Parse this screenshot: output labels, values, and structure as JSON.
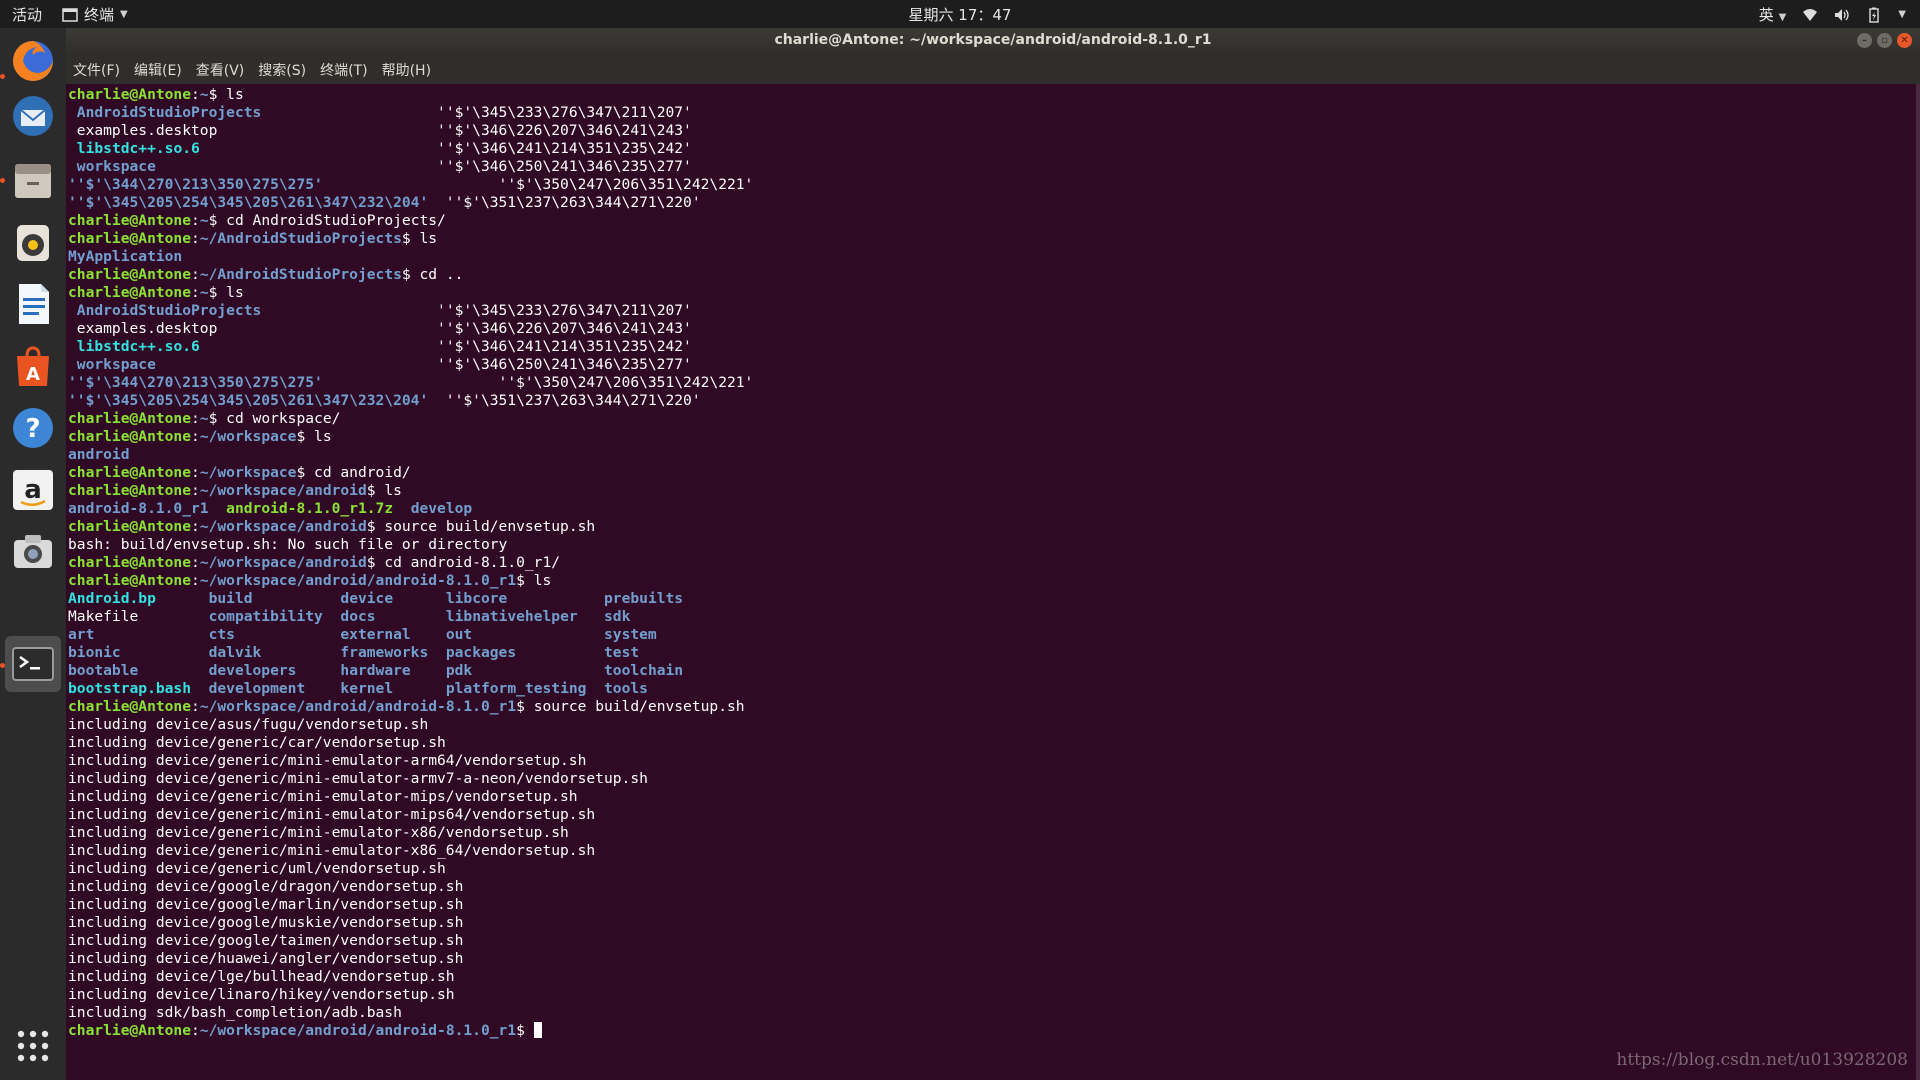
{
  "top_panel": {
    "activities": "活动",
    "app_menu": "终端",
    "clock": "星期六 17：47",
    "input_method": "英"
  },
  "window": {
    "title": "charlie@Antone: ~/workspace/android/android-8.1.0_r1"
  },
  "menubar": [
    "文件(F)",
    "编辑(E)",
    "查看(V)",
    "搜索(S)",
    "终端(T)",
    "帮助(H)"
  ],
  "dock": {
    "items": [
      {
        "name": "firefox"
      },
      {
        "name": "thunderbird"
      },
      {
        "name": "files"
      },
      {
        "name": "rhythmbox"
      },
      {
        "name": "libreoffice-writer"
      },
      {
        "name": "ubuntu-software"
      },
      {
        "name": "help"
      },
      {
        "name": "amazon"
      },
      {
        "name": "screenshot"
      },
      {
        "name": "terminal"
      }
    ]
  },
  "colors": {
    "terminal_bg": "#300a24",
    "prompt_green": "#8ae234",
    "dir_blue": "#729fcf",
    "link_cyan": "#34e2e2",
    "accent_orange": "#e95420"
  },
  "terminal": {
    "user": "charlie@Antone",
    "lines": [
      [
        {
          "t": "charlie@Antone",
          "c": "prompt"
        },
        {
          "t": ":"
        },
        {
          "t": "~",
          "c": "path"
        },
        {
          "t": "$ ls"
        }
      ],
      [
        {
          "t": " "
        },
        {
          "t": "AndroidStudioProjects",
          "c": "dir"
        },
        {
          "t": "                    ''$'\\345\\233\\276\\347\\211\\207'"
        }
      ],
      [
        {
          "t": " examples.desktop                         ''$'\\346\\226\\207\\346\\241\\243'"
        }
      ],
      [
        {
          "t": " "
        },
        {
          "t": "libstdc++.so.6",
          "c": "link"
        },
        {
          "t": "                           ''$'\\346\\241\\214\\351\\235\\242'"
        }
      ],
      [
        {
          "t": " "
        },
        {
          "t": "workspace",
          "c": "dir"
        },
        {
          "t": "                                ''$'\\346\\250\\241\\346\\235\\277'"
        }
      ],
      [
        {
          "t": "''$'\\344\\270\\213\\350\\275\\275'",
          "c": "dir"
        },
        {
          "t": "                    ''$'\\350\\247\\206\\351\\242\\221'"
        }
      ],
      [
        {
          "t": "''$'\\345\\205\\254\\345\\205\\261\\347\\232\\204'",
          "c": "dir"
        },
        {
          "t": "  ''$'\\351\\237\\263\\344\\271\\220'"
        }
      ],
      [
        {
          "t": "charlie@Antone",
          "c": "prompt"
        },
        {
          "t": ":"
        },
        {
          "t": "~",
          "c": "path"
        },
        {
          "t": "$ cd AndroidStudioProjects/"
        }
      ],
      [
        {
          "t": "charlie@Antone",
          "c": "prompt"
        },
        {
          "t": ":"
        },
        {
          "t": "~/AndroidStudioProjects",
          "c": "path"
        },
        {
          "t": "$ ls"
        }
      ],
      [
        {
          "t": "MyApplication",
          "c": "dir"
        }
      ],
      [
        {
          "t": "charlie@Antone",
          "c": "prompt"
        },
        {
          "t": ":"
        },
        {
          "t": "~/AndroidStudioProjects",
          "c": "path"
        },
        {
          "t": "$ cd .."
        }
      ],
      [
        {
          "t": "charlie@Antone",
          "c": "prompt"
        },
        {
          "t": ":"
        },
        {
          "t": "~",
          "c": "path"
        },
        {
          "t": "$ ls"
        }
      ],
      [
        {
          "t": " "
        },
        {
          "t": "AndroidStudioProjects",
          "c": "dir"
        },
        {
          "t": "                    ''$'\\345\\233\\276\\347\\211\\207'"
        }
      ],
      [
        {
          "t": " examples.desktop                         ''$'\\346\\226\\207\\346\\241\\243'"
        }
      ],
      [
        {
          "t": " "
        },
        {
          "t": "libstdc++.so.6",
          "c": "link"
        },
        {
          "t": "                           ''$'\\346\\241\\214\\351\\235\\242'"
        }
      ],
      [
        {
          "t": " "
        },
        {
          "t": "workspace",
          "c": "dir"
        },
        {
          "t": "                                ''$'\\346\\250\\241\\346\\235\\277'"
        }
      ],
      [
        {
          "t": "''$'\\344\\270\\213\\350\\275\\275'",
          "c": "dir"
        },
        {
          "t": "                    ''$'\\350\\247\\206\\351\\242\\221'"
        }
      ],
      [
        {
          "t": "''$'\\345\\205\\254\\345\\205\\261\\347\\232\\204'",
          "c": "dir"
        },
        {
          "t": "  ''$'\\351\\237\\263\\344\\271\\220'"
        }
      ],
      [
        {
          "t": "charlie@Antone",
          "c": "prompt"
        },
        {
          "t": ":"
        },
        {
          "t": "~",
          "c": "path"
        },
        {
          "t": "$ cd workspace/"
        }
      ],
      [
        {
          "t": "charlie@Antone",
          "c": "prompt"
        },
        {
          "t": ":"
        },
        {
          "t": "~/workspace",
          "c": "path"
        },
        {
          "t": "$ ls"
        }
      ],
      [
        {
          "t": "android",
          "c": "dir"
        }
      ],
      [
        {
          "t": "charlie@Antone",
          "c": "prompt"
        },
        {
          "t": ":"
        },
        {
          "t": "~/workspace",
          "c": "path"
        },
        {
          "t": "$ cd android/"
        }
      ],
      [
        {
          "t": "charlie@Antone",
          "c": "prompt"
        },
        {
          "t": ":"
        },
        {
          "t": "~/workspace/android",
          "c": "path"
        },
        {
          "t": "$ ls"
        }
      ],
      [
        {
          "t": "android-8.1.0_r1",
          "c": "dir"
        },
        {
          "t": "  "
        },
        {
          "t": "android-8.1.0_r1.7z",
          "c": "exec"
        },
        {
          "t": "  "
        },
        {
          "t": "develop",
          "c": "dir"
        }
      ],
      [
        {
          "t": "charlie@Antone",
          "c": "prompt"
        },
        {
          "t": ":"
        },
        {
          "t": "~/workspace/android",
          "c": "path"
        },
        {
          "t": "$ source build/envsetup.sh"
        }
      ],
      [
        {
          "t": "bash: build/envsetup.sh: No such file or directory"
        }
      ],
      [
        {
          "t": "charlie@Antone",
          "c": "prompt"
        },
        {
          "t": ":"
        },
        {
          "t": "~/workspace/android",
          "c": "path"
        },
        {
          "t": "$ cd android-8.1.0_r1/"
        }
      ],
      [
        {
          "t": "charlie@Antone",
          "c": "prompt"
        },
        {
          "t": ":"
        },
        {
          "t": "~/workspace/android/android-8.1.0_r1",
          "c": "path"
        },
        {
          "t": "$ ls"
        }
      ],
      [
        {
          "t": "Android.bp",
          "c": "link"
        },
        {
          "t": "      "
        },
        {
          "t": "build",
          "c": "dir"
        },
        {
          "t": "          "
        },
        {
          "t": "device",
          "c": "dir"
        },
        {
          "t": "      "
        },
        {
          "t": "libcore",
          "c": "dir"
        },
        {
          "t": "           "
        },
        {
          "t": "prebuilts",
          "c": "dir"
        }
      ],
      [
        {
          "t": "Makefile        "
        },
        {
          "t": "compatibility",
          "c": "dir"
        },
        {
          "t": "  "
        },
        {
          "t": "docs",
          "c": "dir"
        },
        {
          "t": "        "
        },
        {
          "t": "libnativehelper",
          "c": "dir"
        },
        {
          "t": "   "
        },
        {
          "t": "sdk",
          "c": "dir"
        }
      ],
      [
        {
          "t": "art",
          "c": "dir"
        },
        {
          "t": "             "
        },
        {
          "t": "cts",
          "c": "dir"
        },
        {
          "t": "            "
        },
        {
          "t": "external",
          "c": "dir"
        },
        {
          "t": "    "
        },
        {
          "t": "out",
          "c": "dir"
        },
        {
          "t": "               "
        },
        {
          "t": "system",
          "c": "dir"
        }
      ],
      [
        {
          "t": "bionic",
          "c": "dir"
        },
        {
          "t": "          "
        },
        {
          "t": "dalvik",
          "c": "dir"
        },
        {
          "t": "         "
        },
        {
          "t": "frameworks",
          "c": "dir"
        },
        {
          "t": "  "
        },
        {
          "t": "packages",
          "c": "dir"
        },
        {
          "t": "          "
        },
        {
          "t": "test",
          "c": "dir"
        }
      ],
      [
        {
          "t": "bootable",
          "c": "dir"
        },
        {
          "t": "        "
        },
        {
          "t": "developers",
          "c": "dir"
        },
        {
          "t": "     "
        },
        {
          "t": "hardware",
          "c": "dir"
        },
        {
          "t": "    "
        },
        {
          "t": "pdk",
          "c": "dir"
        },
        {
          "t": "               "
        },
        {
          "t": "toolchain",
          "c": "dir"
        }
      ],
      [
        {
          "t": "bootstrap.bash",
          "c": "link"
        },
        {
          "t": "  "
        },
        {
          "t": "development",
          "c": "dir"
        },
        {
          "t": "    "
        },
        {
          "t": "kernel",
          "c": "dir"
        },
        {
          "t": "      "
        },
        {
          "t": "platform_testing",
          "c": "dir"
        },
        {
          "t": "  "
        },
        {
          "t": "tools",
          "c": "dir"
        }
      ],
      [
        {
          "t": "charlie@Antone",
          "c": "prompt"
        },
        {
          "t": ":"
        },
        {
          "t": "~/workspace/android/android-8.1.0_r1",
          "c": "path"
        },
        {
          "t": "$ source build/envsetup.sh"
        }
      ],
      [
        {
          "t": "including device/asus/fugu/vendorsetup.sh"
        }
      ],
      [
        {
          "t": "including device/generic/car/vendorsetup.sh"
        }
      ],
      [
        {
          "t": "including device/generic/mini-emulator-arm64/vendorsetup.sh"
        }
      ],
      [
        {
          "t": "including device/generic/mini-emulator-armv7-a-neon/vendorsetup.sh"
        }
      ],
      [
        {
          "t": "including device/generic/mini-emulator-mips/vendorsetup.sh"
        }
      ],
      [
        {
          "t": "including device/generic/mini-emulator-mips64/vendorsetup.sh"
        }
      ],
      [
        {
          "t": "including device/generic/mini-emulator-x86/vendorsetup.sh"
        }
      ],
      [
        {
          "t": "including device/generic/mini-emulator-x86_64/vendorsetup.sh"
        }
      ],
      [
        {
          "t": "including device/generic/uml/vendorsetup.sh"
        }
      ],
      [
        {
          "t": "including device/google/dragon/vendorsetup.sh"
        }
      ],
      [
        {
          "t": "including device/google/marlin/vendorsetup.sh"
        }
      ],
      [
        {
          "t": "including device/google/muskie/vendorsetup.sh"
        }
      ],
      [
        {
          "t": "including device/google/taimen/vendorsetup.sh"
        }
      ],
      [
        {
          "t": "including device/huawei/angler/vendorsetup.sh"
        }
      ],
      [
        {
          "t": "including device/lge/bullhead/vendorsetup.sh"
        }
      ],
      [
        {
          "t": "including device/linaro/hikey/vendorsetup.sh"
        }
      ],
      [
        {
          "t": "including sdk/bash_completion/adb.bash"
        }
      ],
      [
        {
          "t": "charlie@Antone",
          "c": "prompt"
        },
        {
          "t": ":"
        },
        {
          "t": "~/workspace/android/android-8.1.0_r1",
          "c": "path"
        },
        {
          "t": "$ "
        }
      ]
    ]
  },
  "watermark": "https://blog.csdn.net/u013928208"
}
